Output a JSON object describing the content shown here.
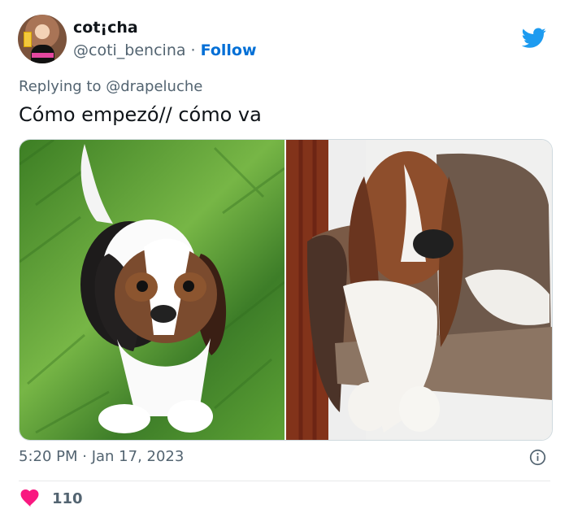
{
  "user": {
    "display_name": "cot¡cha",
    "handle": "@coti_bencina",
    "separator": " · ",
    "follow_label": "Follow"
  },
  "reply": {
    "prefix": "Replying to ",
    "mention": "@drapeluche"
  },
  "tweet": {
    "text": "Cómo empezó// cómo va",
    "timestamp": "5:20 PM · Jan 17, 2023",
    "like_count": "110"
  },
  "colors": {
    "accent": "#006fd6",
    "twitter_blue": "#1d9bf0",
    "heart": "#f91880",
    "muted": "#536471",
    "text": "#0f1419",
    "border": "#cfd9de"
  },
  "icons": {
    "logo": "twitter-bird-icon",
    "info": "info-icon",
    "like": "heart-icon"
  },
  "media": {
    "items": [
      "basset-hound-puppy-photo",
      "adult-basset-hound-photo"
    ]
  }
}
